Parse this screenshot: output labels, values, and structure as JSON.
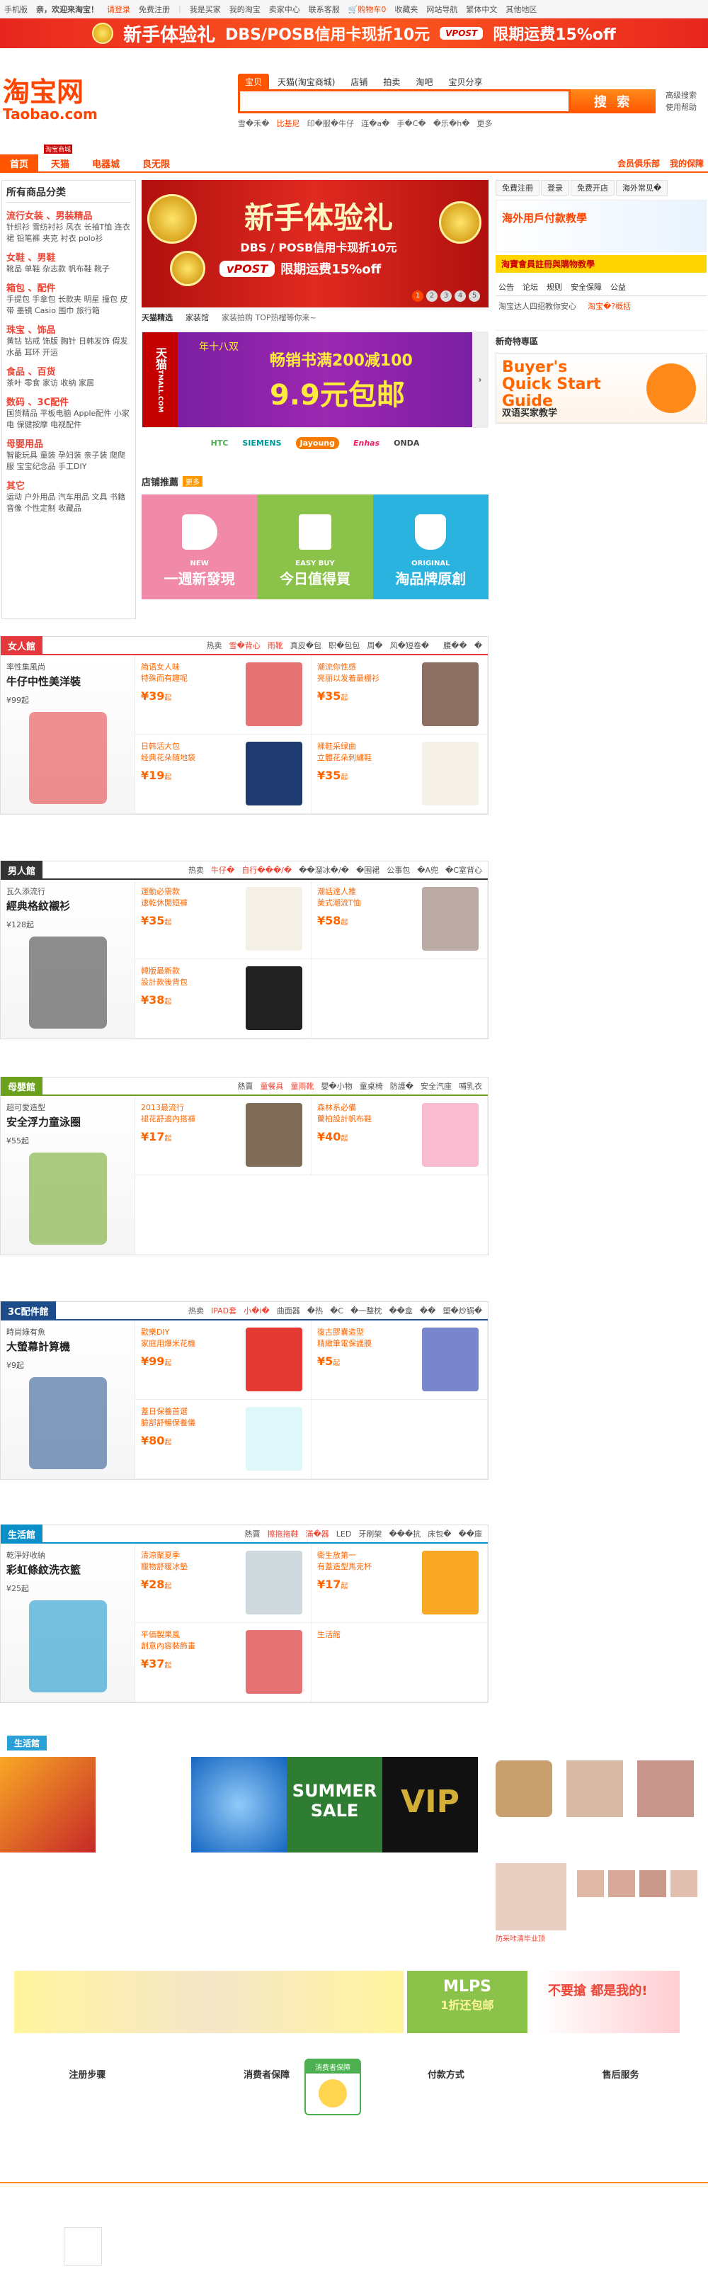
{
  "topbar": {
    "phone": "手机版",
    "welcome": "亲，欢迎来淘宝！",
    "login": "请登录",
    "register": "免费注册",
    "mytaobao": "我的淘宝",
    "cart": "购物车",
    "cart_count": "0",
    "fav": "收藏夹",
    "sitemap": "网站导航",
    "lang": "繁体中文",
    "region": "其他地区",
    "seller": "卖家中心",
    "contact": "联系客服",
    "buyer": "我是买家"
  },
  "banner": {
    "title": "新手体验礼",
    "text": "DBS/POSB信用卡现折10元",
    "vpost": "VPOST",
    "rest": "限期运费15%off"
  },
  "logo": {
    "cn": "淘宝网",
    "en": "Taobao.com"
  },
  "search": {
    "tabs": [
      "宝贝",
      "天猫(淘宝商城)",
      "店铺",
      "拍卖",
      "淘吧",
      "宝贝分享"
    ],
    "button": "搜 索",
    "placeholder": "",
    "hot": [
      "雪�禾�",
      "比基尼",
      "印�服�牛仔",
      "",
      "连�a�",
      "",
      "手�C�",
      "�乐�h�",
      "更多"
    ],
    "right1": "高级搜索",
    "right2": "使用帮助"
  },
  "nav": {
    "tabs": [
      "首页",
      "天猫",
      "电器城",
      "良无限"
    ],
    "tmall_badge": "淘宝商城",
    "right": [
      "会员俱乐部",
      "我的保障"
    ]
  },
  "cats": {
    "title": "所有商品分类",
    "groups": [
      {
        "h": "流行女装 、男装精品",
        "items": "针织衫 雪纺衬衫 风衣 长袖T恤 连衣裙 铅笔裤 夹克 衬衣 polo衫"
      },
      {
        "h": "女鞋 、男鞋",
        "items": "靴品 单鞋 杂志款 帆布鞋 靴子"
      },
      {
        "h": "箱包 、配件",
        "items": "手提包 手拿包 长款夹 明星 撞包 皮带 墨镜 Casio 围巾 旅行箱"
      },
      {
        "h": "珠宝 、饰品",
        "items": "黄钻 钻戒 饰版 胸针 日韩发饰 假发 水晶 耳环 开运"
      },
      {
        "h": "食品 、百货",
        "items": "茶叶 零食 家访 收纳 家居"
      },
      {
        "h": "数码 、3C配件",
        "items": "国货精品 平板电脑 Apple配件 小家电 保健按摩 电视配件"
      },
      {
        "h": "母婴用品",
        "items": "智能玩具 童装 孕妇装 亲子装 爬爬服 宝宝纪念品 手工DIY"
      },
      {
        "h": "其它",
        "items": "运动 户外用品 汽车用品 文具 书籍 音像 个性定制 收藏品"
      }
    ]
  },
  "hero": {
    "title": "新手体验礼",
    "sub": "DBS / POSB信用卡现折10元",
    "vpost": "vPOST",
    "rest": "限期运费15%off",
    "dots": [
      "1",
      "2",
      "3",
      "4",
      "5"
    ]
  },
  "tabs2": {
    "items": [
      "天猫精选",
      "家装馆",
      "家装拍购 TOP热榴等你来~"
    ]
  },
  "tmall": {
    "brand": "天猫",
    "domain": "TMALL.COM",
    "big": "畅销书满200减100",
    "price": "9.9元包邮",
    "sub": "年十八双"
  },
  "brands": [
    "HTC",
    "SIEMENS",
    "Jayoung",
    "Enhas",
    "ONDA"
  ],
  "rec": {
    "title": "店铺推薦",
    "more": "更多",
    "tiles": [
      "一週新發現",
      "今日值得買",
      "淘品牌原創"
    ],
    "sub": [
      "NEW",
      "EASY BUY",
      "ORIGINAL"
    ]
  },
  "right": {
    "tabs": [
      "免費注冊",
      "登录",
      "免费开店",
      "海外常见�"
    ],
    "ad1": "海外用戶付款教學",
    "ad2": "淘寶會員註冊與購物教學",
    "notice_tabs": [
      "公告",
      "论坛",
      "规则",
      "安全保障",
      "公益"
    ],
    "notices": [
      "淘宝达人四招教你安心",
      "淘宝�?概括"
    ],
    "newbie": "新奇特専區",
    "guide": "Buyer's Quick Start Guide",
    "guide_cn": "双语买家教学"
  },
  "sections": [
    {
      "id": "women",
      "tag": "女人館",
      "color": "#e4393c",
      "hot": [
        "热卖",
        "雪�背心",
        "雨靴",
        "真皮�包",
        "职�包包",
        "周�",
        "风�短卷�",
        "",
        "腰��",
        "�"
      ],
      "feature": {
        "t1": "率性集風尚",
        "t2": "牛仔中性美洋裝",
        "price": "¥99起"
      },
      "cells": [
        {
          "a": "简语女人味",
          "b": "特殊而有趣呢",
          "p": "39"
        },
        {
          "a": "潮流你性感",
          "b": "亮丽以发着最棚衫",
          "p": "35"
        },
        {
          "a": "日韩活大包",
          "b": "经典花朵随地袋",
          "p": "19"
        },
        {
          "a": "裸鞋采绿曲",
          "b": "立體花朵刺繡鞋",
          "p": "35"
        }
      ]
    },
    {
      "id": "men",
      "tag": "男人館",
      "color": "#333",
      "hot": [
        "热卖",
        "牛仔�",
        "自行���/�",
        "��溜冰�/�",
        "�围裙",
        "公事包",
        "�A兜",
        "�C室背心"
      ],
      "feature": {
        "t1": "瓦久添流行",
        "t2": "經典格紋襯衫",
        "price": "¥128起"
      },
      "cells": [
        {
          "a": "運動必需款",
          "b": "速乾休閒短褲",
          "p": "35"
        },
        {
          "a": "潮話達人推",
          "b": "美式潮流T恤",
          "p": "58"
        },
        {
          "a": "韓版最新款",
          "b": "設計款後背包",
          "p": "38"
        },
        {
          "a": "",
          "b": "",
          "p": ""
        }
      ]
    },
    {
      "id": "baby",
      "tag": "母嬰館",
      "color": "#6aa01c",
      "hot": [
        "熱賣",
        "童餐具",
        "童雨靴",
        "嬰�小物",
        "童桌椅",
        "防護�",
        "安全汽座",
        "哺乳衣"
      ],
      "feature": {
        "t1": "超可愛造型",
        "t2": "安全浮力童泳圈",
        "price": "¥55起"
      },
      "cells": [
        {
          "a": "2013最流行",
          "b": "褪花舒適內搭褲",
          "p": "17"
        },
        {
          "a": "森林系必備",
          "b": "蘭柏設計帆布鞋",
          "p": "40"
        }
      ]
    },
    {
      "id": "digital",
      "tag": "3C配件館",
      "color": "#1e4c8a",
      "hot": [
        "热卖",
        "IPAD套",
        "小�i�",
        "曲面器",
        "�热",
        "�C",
        "�一整枕",
        "��盒",
        "��",
        "塑�炒锅�"
      ],
      "feature": {
        "t1": "時尚綠有魚",
        "t2": "大螢幕計算機",
        "price": "¥9起"
      },
      "cells": [
        {
          "a": "歡樂DIY",
          "b": "家庭用爆米花機",
          "p": "99"
        },
        {
          "a": "復古膠囊造型",
          "b": "精緻筆電保護膜",
          "p": "5"
        },
        {
          "a": "蓋日保養首選",
          "b": "臉部舒暢保養儀",
          "p": "80"
        },
        {
          "a": "",
          "b": "",
          "p": ""
        }
      ]
    },
    {
      "id": "life",
      "tag": "生活館",
      "color": "#0a8fc9",
      "hot": [
        "熱賣",
        "擦拖拖鞋",
        "滿�器",
        "LED",
        "牙刷架",
        "���抗",
        "床包�",
        "��庫"
      ],
      "feature": {
        "t1": "乾淨好收納",
        "t2": "彩虹條紋洗衣籃",
        "price": "¥25起"
      },
      "cells": [
        {
          "a": "清涼聚夏季",
          "b": "寵物舒暖冰墊",
          "p": "28"
        },
        {
          "a": "衛生放第一",
          "b": "有蓋造型馬克杯",
          "p": "17"
        },
        {
          "a": "平価製果風",
          "b": "創意內容裝飾畫",
          "p": "37"
        },
        {
          "a": "生活館",
          "b": "",
          "p": ""
        }
      ]
    }
  ],
  "promo": {
    "tag": "生活館",
    "summer": "SUMMER SALE",
    "vip": "VIP",
    "mlps": "MLPS",
    "mlps_sub": "1折还包邮",
    "grab": "不要搶 都是我的!",
    "caption": "防采咔清毕业顶"
  },
  "footer": {
    "items": [
      "注册步骤",
      "消费者保障",
      "付款方式",
      "售后服务"
    ],
    "badge": "消费者保障"
  }
}
